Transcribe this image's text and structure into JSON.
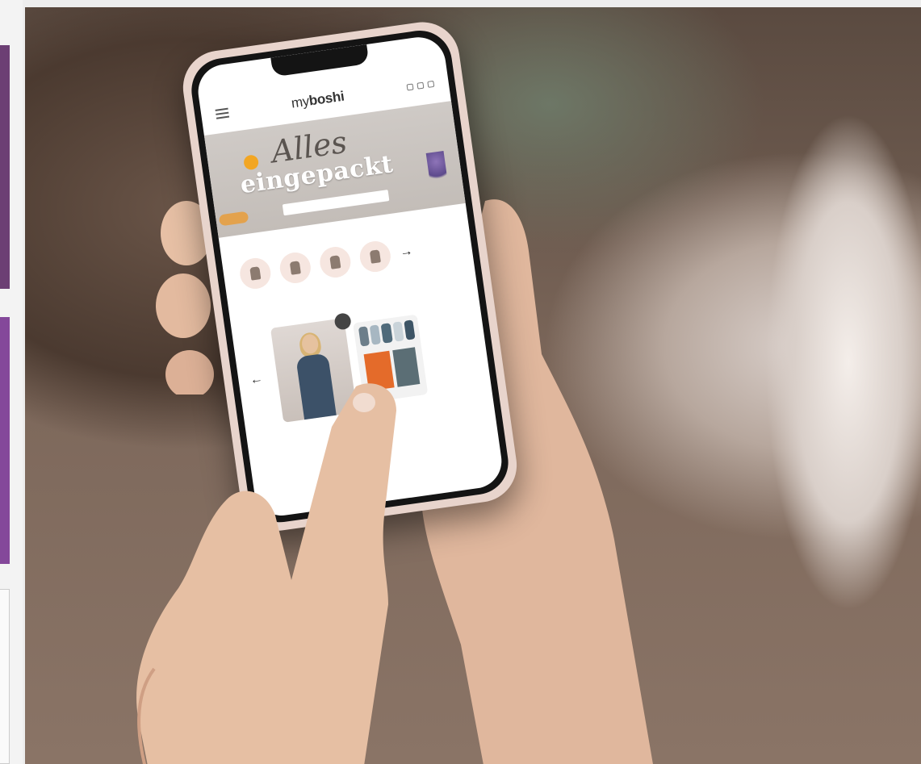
{
  "scene": {
    "description_alt": "Hands holding a smartphone showing a shopping app",
    "colors": {
      "sidebar_purple_dark": "#6c3f74",
      "sidebar_purple_light": "#84489a",
      "phone_case": "#e8d4cc",
      "skin": "#e0b79d",
      "banner_bg": "#cfcac6",
      "accent_orange": "#f2a623"
    }
  },
  "app": {
    "brand_prefix": "my",
    "brand_name": "boshi",
    "banner_script": "Alles",
    "banner_slab": "eingepackt",
    "banner_button": "",
    "category_count": 4,
    "card1_price": "",
    "card2_price": ""
  },
  "icons": [
    "hamburger-icon",
    "account-icon",
    "wishlist-icon",
    "cart-icon",
    "arrow-right-icon",
    "arrow-left-icon"
  ]
}
